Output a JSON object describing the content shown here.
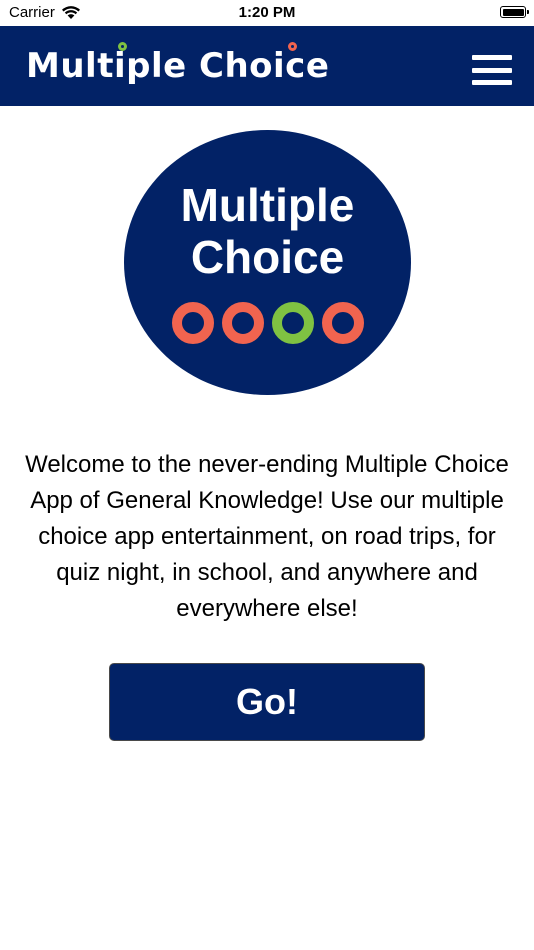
{
  "status_bar": {
    "carrier": "Carrier",
    "time": "1:20 PM",
    "wifi_icon": "wifi-icon",
    "battery_icon": "battery-icon",
    "battery_level": 1.0
  },
  "nav_bar": {
    "logo_text": "Multiple Choice",
    "menu_icon": "hamburger-menu-icon",
    "background_color": "#022266"
  },
  "logo": {
    "line1": "Multiple",
    "line2": "Choice",
    "rings": [
      {
        "color": "#f1644f"
      },
      {
        "color": "#f1644f"
      },
      {
        "color": "#7fc242"
      },
      {
        "color": "#f1644f"
      }
    ]
  },
  "welcome_text": "Welcome to the never-ending Multiple Choice App of General Knowledge! Use our multiple choice app entertainment, on road trips, for quiz night, in school, and anywhere and everywhere else!",
  "go_button": {
    "label": "Go!"
  },
  "colors": {
    "brand_navy": "#022266",
    "accent_coral": "#f1644f",
    "accent_green": "#7fc242"
  }
}
